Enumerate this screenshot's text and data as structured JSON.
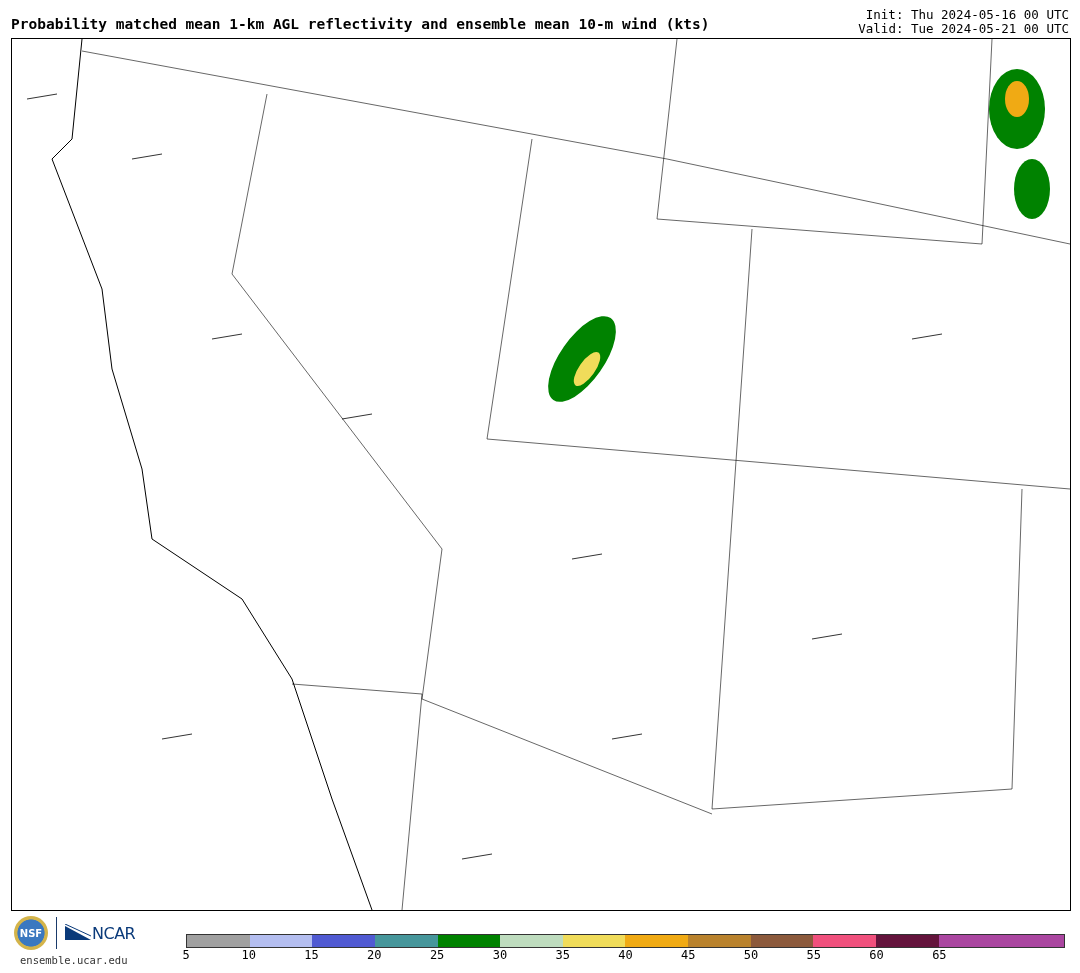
{
  "header": {
    "title": "Probability matched mean 1-km AGL reflectivity and ensemble mean 10-m wind (kts)",
    "init": "Init: Thu 2024-05-16 00 UTC",
    "valid": "Valid: Tue 2024-05-21 00 UTC"
  },
  "footer": {
    "logos": [
      {
        "kind": "seal",
        "text": "NSF"
      },
      {
        "kind": "wordmark",
        "text": "NCAR"
      }
    ],
    "url": "ensemble.ucar.edu"
  },
  "colorbar": {
    "bins": [
      {
        "label": "5",
        "color": "#a0a0a0"
      },
      {
        "label": "10",
        "color": "#b4bef0"
      },
      {
        "label": "15",
        "color": "#505ad2"
      },
      {
        "label": "20",
        "color": "#46969b"
      },
      {
        "label": "25",
        "color": "#008200"
      },
      {
        "label": "30",
        "color": "#bedcbe"
      },
      {
        "label": "35",
        "color": "#f0dc5a"
      },
      {
        "label": "40",
        "color": "#f0aa14"
      },
      {
        "label": "45",
        "color": "#b9822d"
      },
      {
        "label": "50",
        "color": "#8c5a3c"
      },
      {
        "label": "55",
        "color": "#f0507d"
      },
      {
        "label": "60",
        "color": "#64143c"
      },
      {
        "label": "65",
        "color": "#aa46a0"
      },
      {
        "color": "#aa46a0"
      }
    ]
  }
}
